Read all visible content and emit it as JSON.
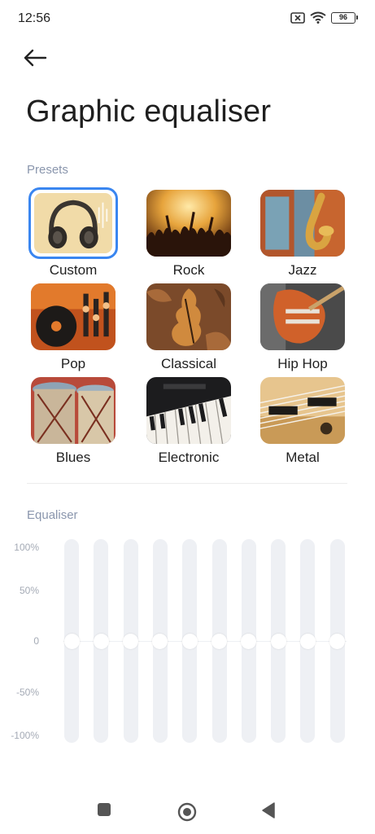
{
  "status_bar": {
    "time": "12:56",
    "battery": "96",
    "icons": [
      "sim-off-icon",
      "wifi-icon",
      "battery-icon"
    ]
  },
  "header": {
    "back_icon": "arrow-left-icon",
    "title": "Graphic equaliser"
  },
  "presets": {
    "label": "Presets",
    "selected": "Custom",
    "accent_color": "#3a86f0",
    "items": [
      {
        "label": "Custom"
      },
      {
        "label": "Rock"
      },
      {
        "label": "Jazz"
      },
      {
        "label": "Pop"
      },
      {
        "label": "Classical"
      },
      {
        "label": "Hip Hop"
      },
      {
        "label": "Blues"
      },
      {
        "label": "Electronic"
      },
      {
        "label": "Metal"
      }
    ]
  },
  "equaliser": {
    "label": "Equaliser",
    "axis_labels": [
      "100%",
      "50%",
      "0",
      "-50%",
      "-100%"
    ],
    "band_count": 10,
    "band_levels_percent": [
      0,
      0,
      0,
      0,
      0,
      0,
      0,
      0,
      0,
      0
    ]
  },
  "nav_bar": {
    "icons": [
      "recents-square-icon",
      "home-circle-icon",
      "back-triangle-icon"
    ]
  }
}
